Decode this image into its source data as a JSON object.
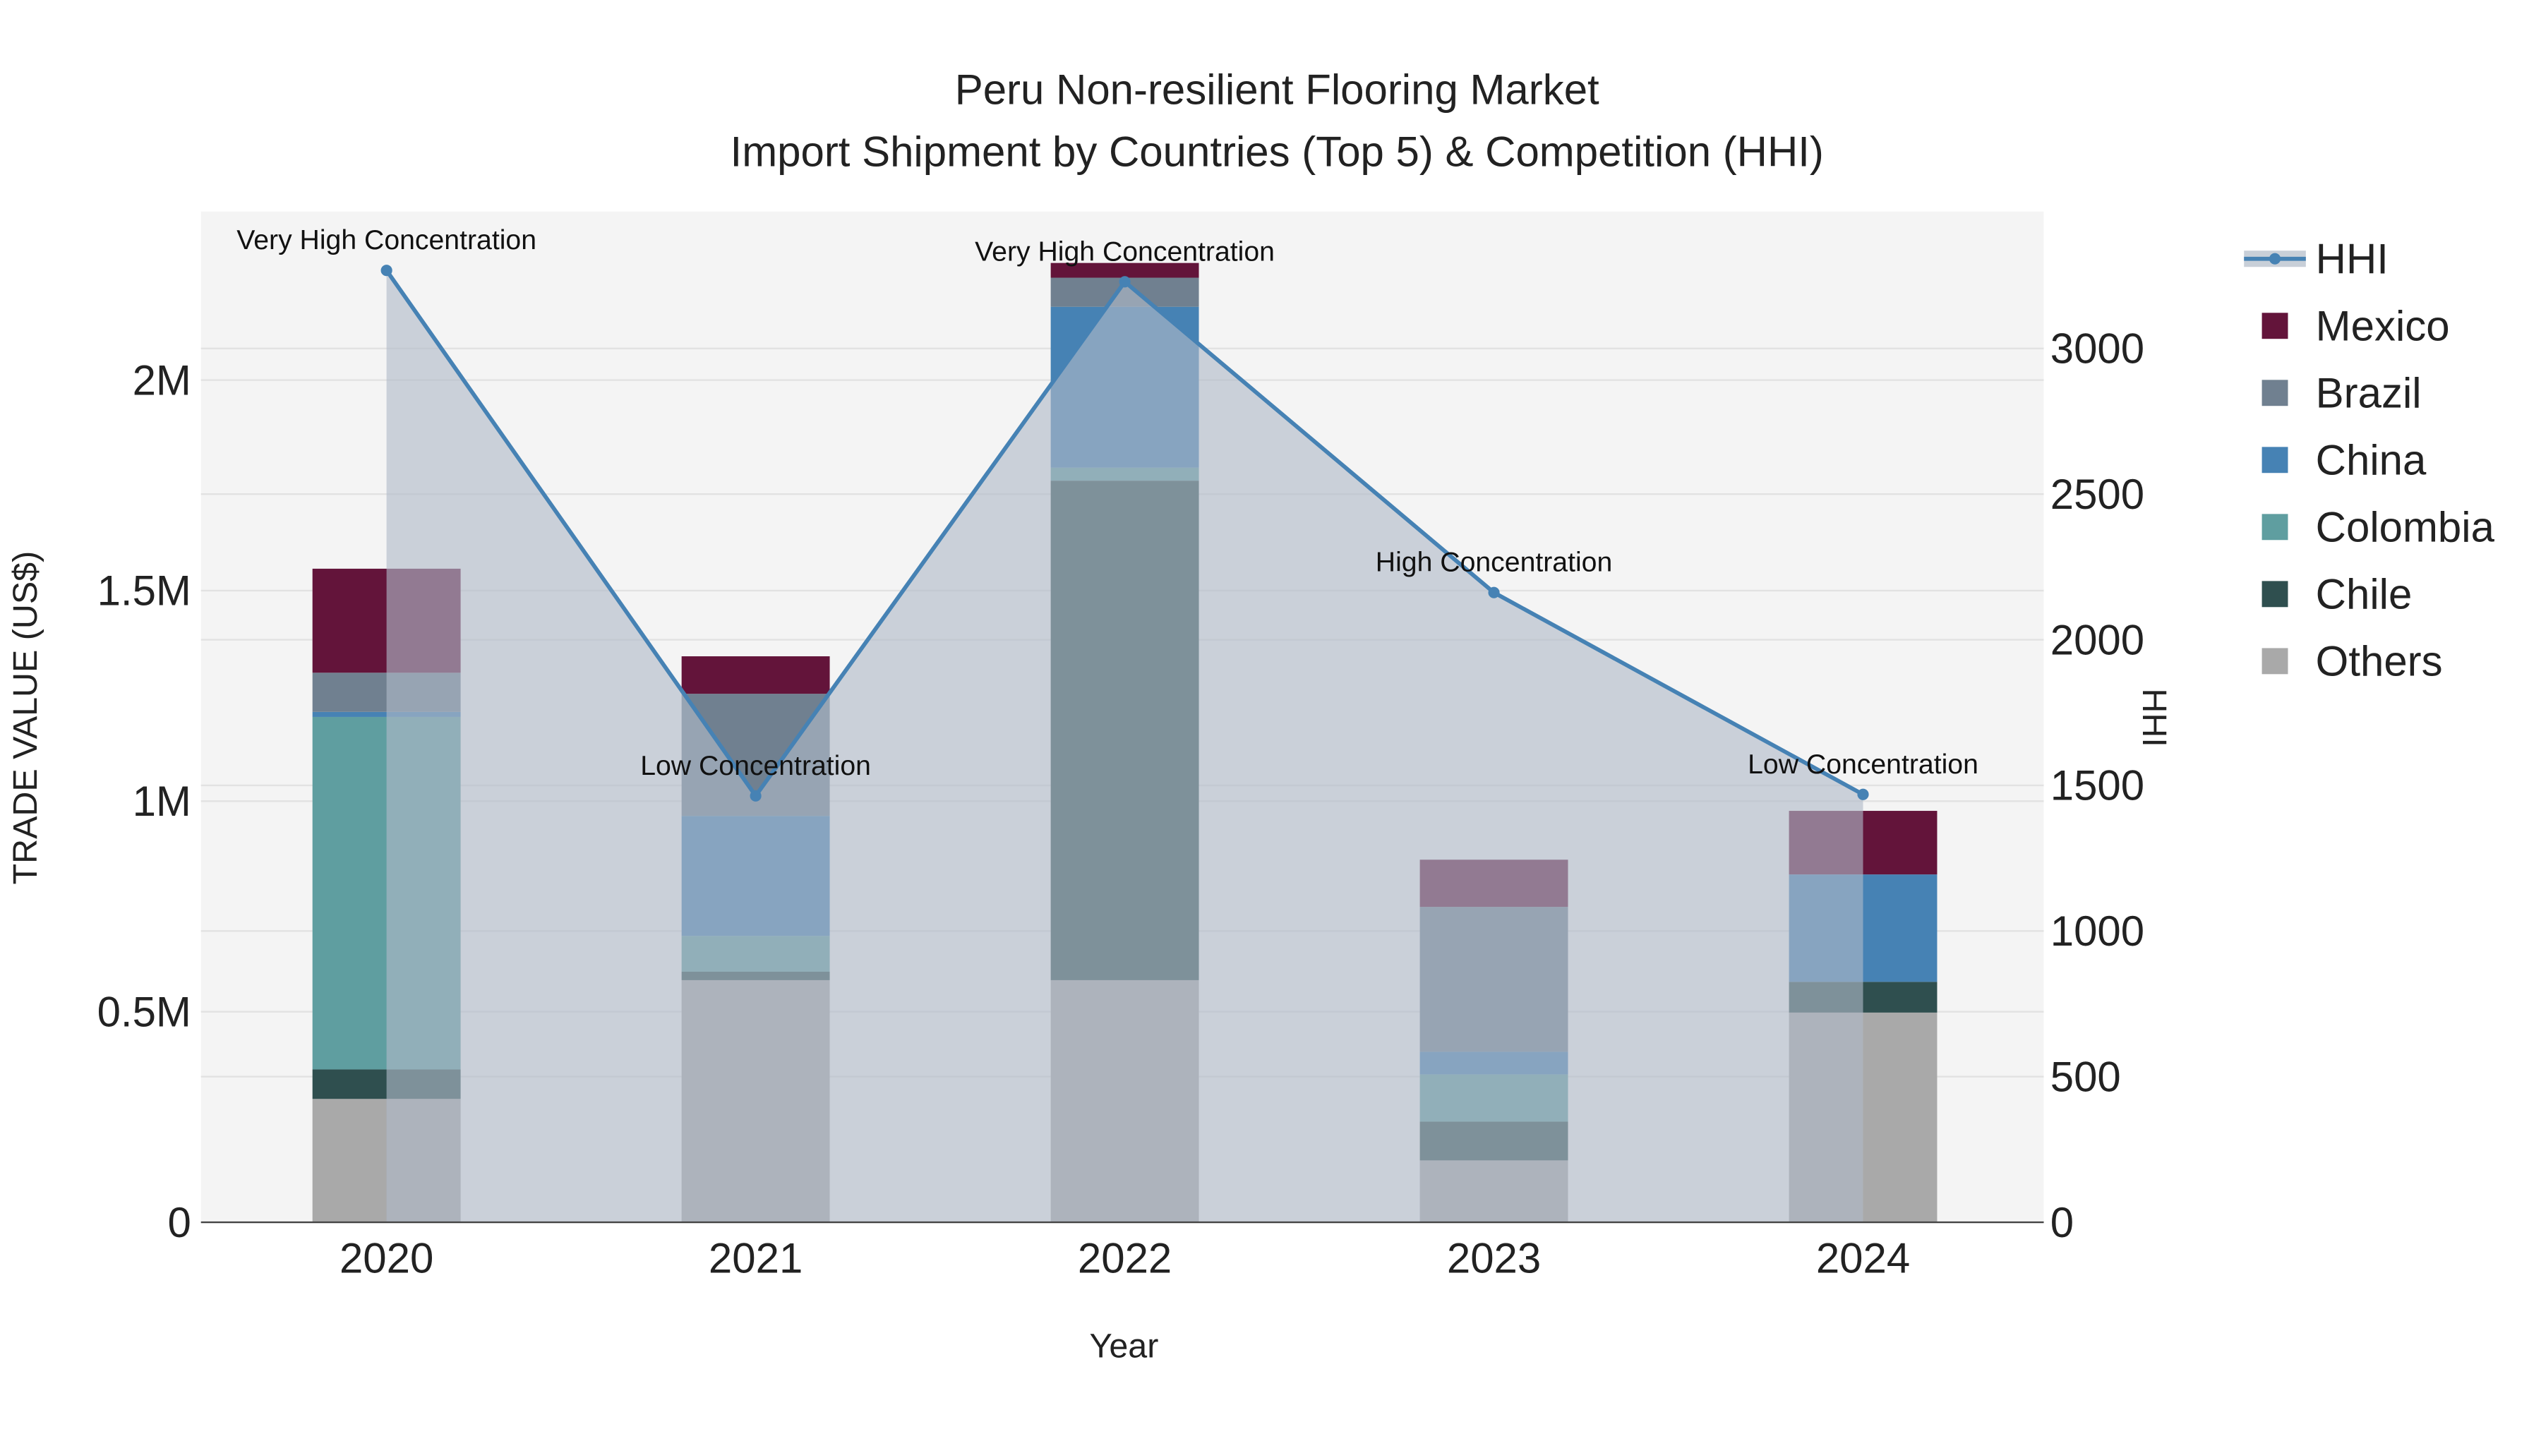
{
  "chart_data": {
    "type": "bar",
    "title": "Peru Non-resilient Flooring Market",
    "subtitle": "Import Shipment by Countries (Top 5) & Competition (HHI)",
    "xlabel": "Year",
    "ylabel": "TRADE VALUE (US$)",
    "y2label": "HHI",
    "categories": [
      "2020",
      "2021",
      "2022",
      "2023",
      "2024"
    ],
    "stacked": true,
    "ylim": [
      0,
      2400000
    ],
    "y2lim": [
      0,
      3470
    ],
    "yticks": [
      {
        "v": 0,
        "label": "0"
      },
      {
        "v": 500000,
        "label": "0.5M"
      },
      {
        "v": 1000000,
        "label": "1M"
      },
      {
        "v": 1500000,
        "label": "1.5M"
      },
      {
        "v": 2000000,
        "label": "2M"
      }
    ],
    "y2ticks": [
      0,
      500,
      1000,
      1500,
      2000,
      2500,
      3000
    ],
    "series": [
      {
        "name": "Others",
        "color": "#a9a9a9",
        "values": [
          293000,
          575000,
          575000,
          147000,
          498000
        ]
      },
      {
        "name": "Chile",
        "color": "#2f4f4f",
        "values": [
          70000,
          20000,
          1186000,
          92000,
          73000
        ]
      },
      {
        "name": "Colombia",
        "color": "#5f9ea0",
        "values": [
          837000,
          85000,
          31000,
          112000,
          0
        ]
      },
      {
        "name": "China",
        "color": "#4682b4",
        "values": [
          12000,
          285000,
          382000,
          54000,
          255000
        ]
      },
      {
        "name": "Brazil",
        "color": "#708090",
        "values": [
          93000,
          290000,
          69000,
          344000,
          0
        ]
      },
      {
        "name": "Mexico",
        "color": "#63143a",
        "values": [
          247000,
          89000,
          35000,
          112000,
          151000
        ]
      }
    ],
    "line": {
      "name": "HHI",
      "color": "#4682b4",
      "values": [
        3268,
        1464,
        3229,
        2162,
        1469
      ]
    },
    "annotations": [
      "Very High Concentration",
      "Low Concentration",
      "Very High Concentration",
      "High Concentration",
      "Low Concentration"
    ],
    "legend": [
      "HHI",
      "Mexico",
      "Brazil",
      "China",
      "Colombia",
      "Chile",
      "Others"
    ],
    "legend_position": "right",
    "grid": true
  }
}
